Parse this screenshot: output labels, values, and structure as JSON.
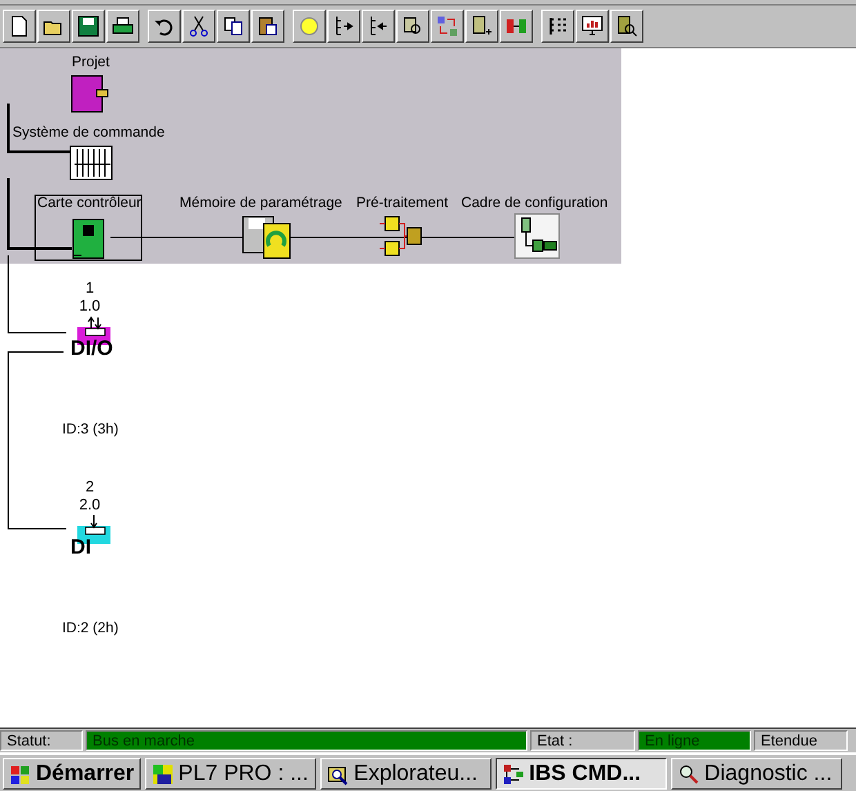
{
  "tree": {
    "root": {
      "label": "Projet"
    },
    "system": {
      "label": "Système de commande"
    },
    "controller": {
      "label": "Carte contrôleur"
    },
    "chain": [
      {
        "label": "Mémoire de paramétrage",
        "kind": "memory"
      },
      {
        "label": "Pré-traitement",
        "kind": "logic"
      },
      {
        "label": "Cadre de configuration",
        "kind": "frame"
      }
    ],
    "devices": [
      {
        "number": "1",
        "address": "1.0",
        "type": "DI/O",
        "id": "ID:3 (3h)",
        "kind": "inout",
        "color": "#d81cd8"
      },
      {
        "number": "2",
        "address": "2.0",
        "type": "DI",
        "id": "ID:2 (2h)",
        "kind": "in",
        "color": "#22d8e0"
      }
    ]
  },
  "status_bar": {
    "status_label": "Statut:",
    "status": "Bus en marche",
    "state_label": "Etat :",
    "state": "En ligne",
    "extent": "Etendue"
  },
  "taskbar": {
    "start": "Démarrer",
    "tasks": [
      {
        "label": "PL7 PRO : ...",
        "kind": "plc",
        "selected": false
      },
      {
        "label": "Explorateu...",
        "kind": "explorer",
        "selected": false
      },
      {
        "label": "IBS CMD...",
        "kind": "ibs",
        "selected": true
      },
      {
        "label": "Diagnostic ...",
        "kind": "diag",
        "selected": false
      }
    ]
  }
}
